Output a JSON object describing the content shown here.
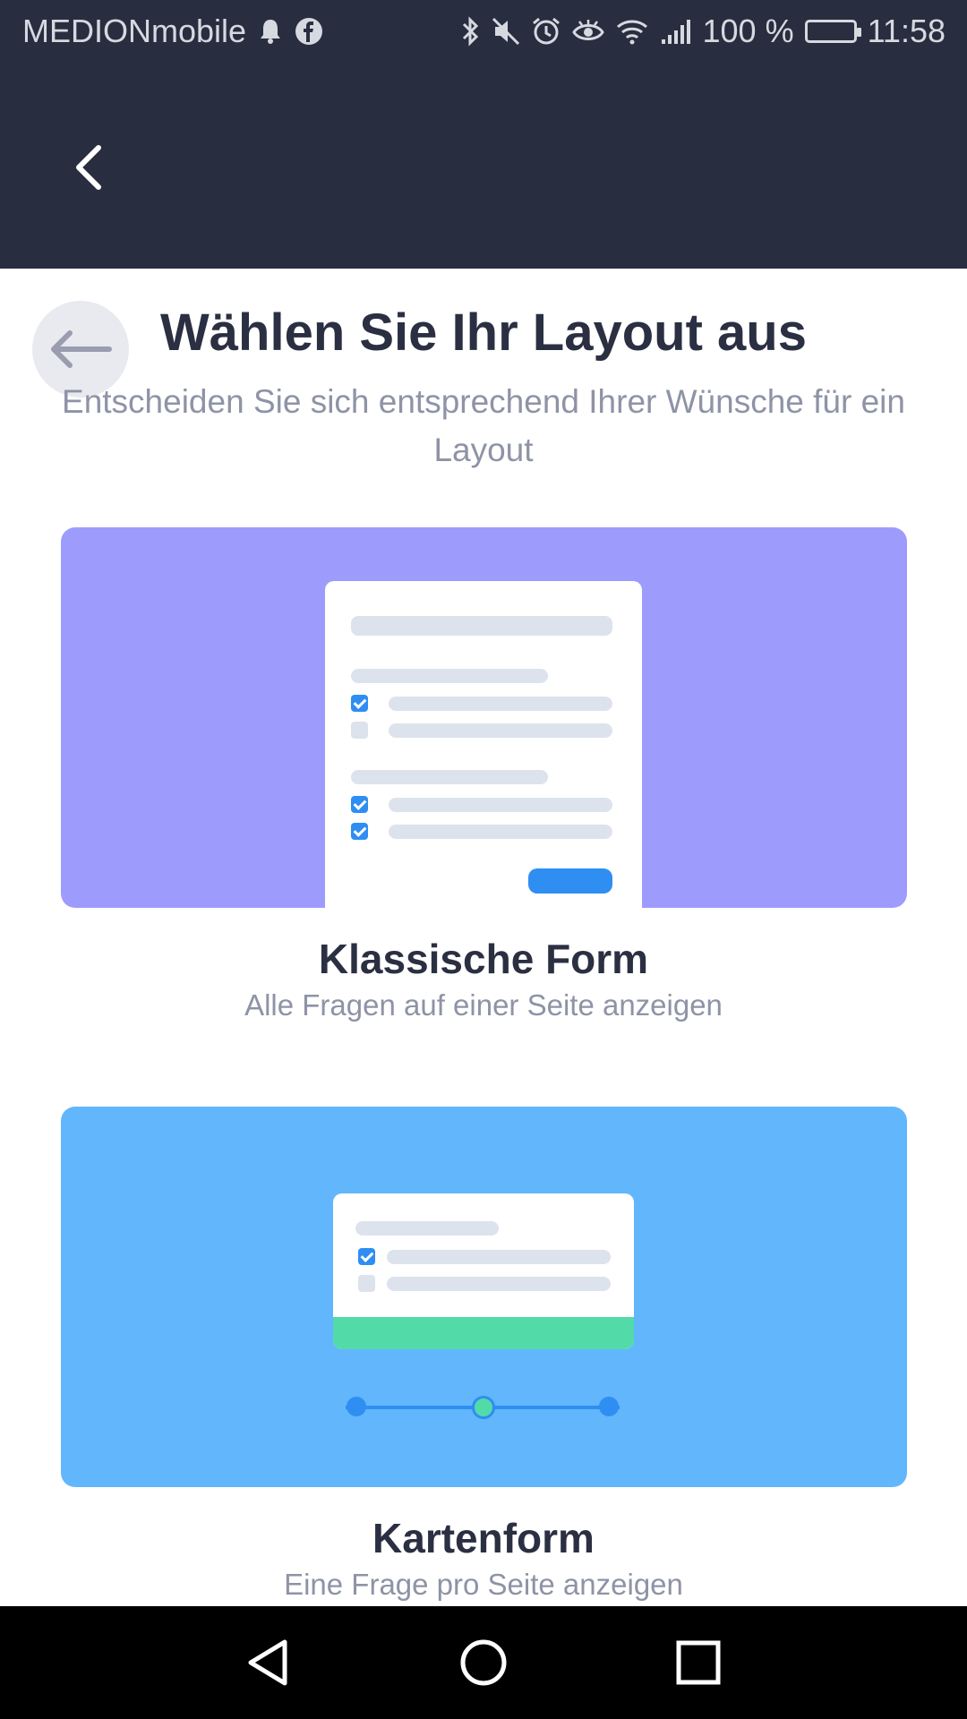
{
  "status_bar": {
    "carrier": "MEDIONmobile",
    "battery_percent": "100 %",
    "time": "11:58",
    "icons": [
      "notification-bell-icon",
      "facebook-icon",
      "bluetooth-icon",
      "mute-icon",
      "alarm-icon",
      "eye-icon",
      "wifi-icon",
      "signal-icon",
      "battery-icon"
    ]
  },
  "app_bar": {
    "back_icon": "chevron-left-icon"
  },
  "page": {
    "title": "Wählen Sie Ihr Layout aus",
    "subtitle": "Entscheiden Sie sich entsprechend Ihrer Wünsche für ein Layout",
    "back_icon": "arrow-left-icon"
  },
  "layouts": [
    {
      "title": "Klassische Form",
      "description": "Alle Fragen auf einer Seite anzeigen",
      "color": "#9d9cfd"
    },
    {
      "title": "Kartenform",
      "description": "Eine Frage pro Seite anzeigen",
      "color": "#62b6fc"
    }
  ],
  "nav_bar": {
    "icons": [
      "nav-back-icon",
      "nav-home-icon",
      "nav-recents-icon"
    ]
  }
}
